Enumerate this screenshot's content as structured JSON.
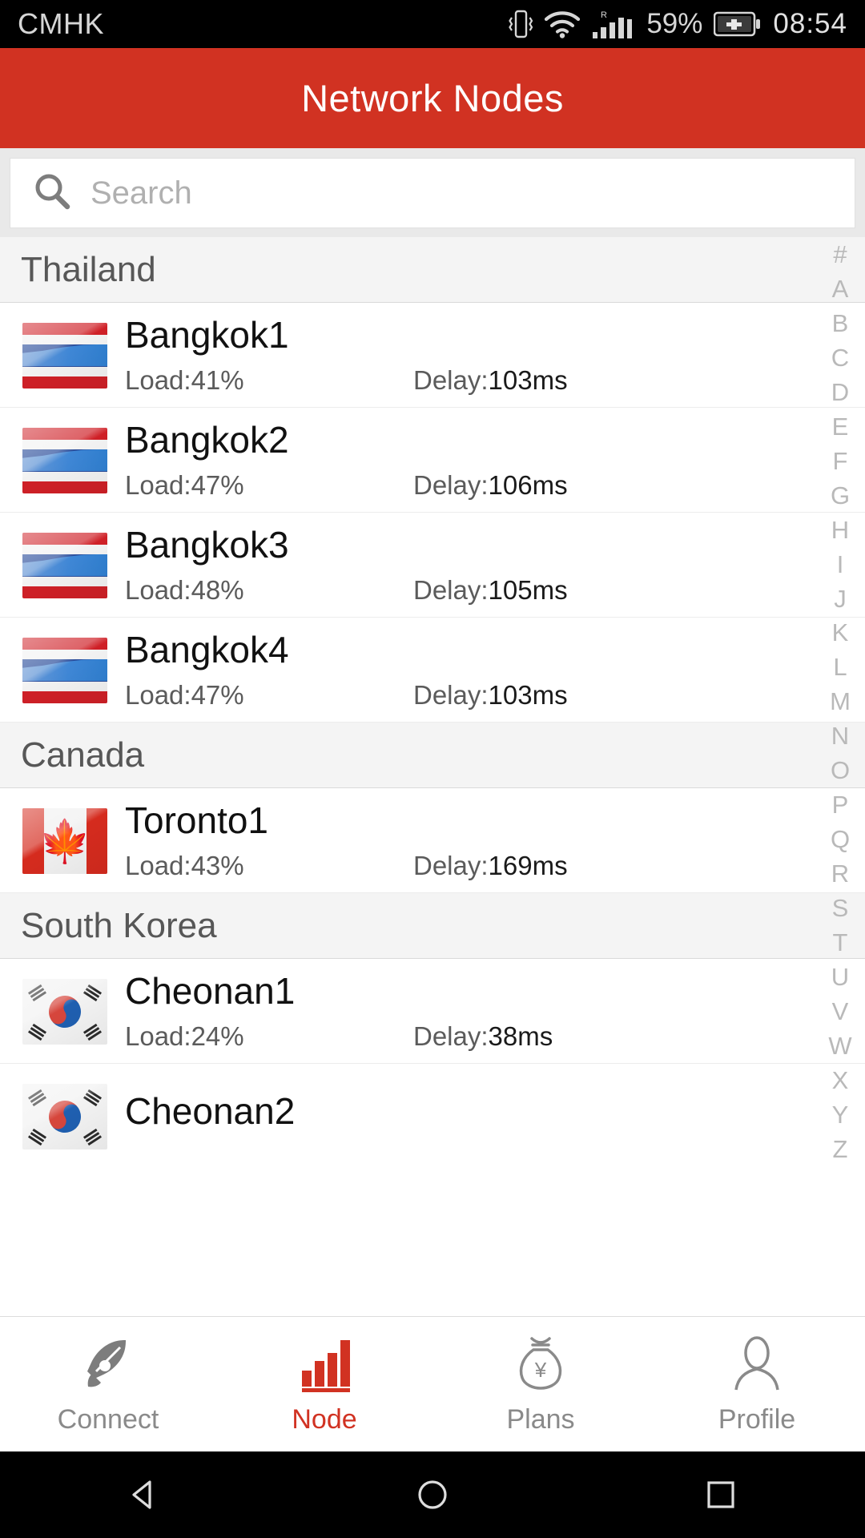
{
  "status_bar": {
    "carrier": "CMHK",
    "battery_percent": "59%",
    "clock": "08:54",
    "icons": [
      "vibrate-icon",
      "wifi-icon",
      "signal-icon",
      "battery-charging-icon"
    ]
  },
  "header": {
    "title": "Network Nodes"
  },
  "search": {
    "placeholder": "Search",
    "value": "",
    "icon": "search-icon"
  },
  "alpha_index": [
    "#",
    "A",
    "B",
    "C",
    "D",
    "E",
    "F",
    "G",
    "H",
    "I",
    "J",
    "K",
    "L",
    "M",
    "N",
    "O",
    "P",
    "Q",
    "R",
    "S",
    "T",
    "U",
    "V",
    "W",
    "X",
    "Y",
    "Z"
  ],
  "sections": [
    {
      "country": "Thailand",
      "flag": "thailand-flag",
      "nodes": [
        {
          "name": "Bangkok1",
          "load": "Load:41%",
          "delay_label": "Delay:",
          "delay": "103ms"
        },
        {
          "name": "Bangkok2",
          "load": "Load:47%",
          "delay_label": "Delay:",
          "delay": "106ms"
        },
        {
          "name": "Bangkok3",
          "load": "Load:48%",
          "delay_label": "Delay:",
          "delay": "105ms"
        },
        {
          "name": "Bangkok4",
          "load": "Load:47%",
          "delay_label": "Delay:",
          "delay": "103ms"
        }
      ]
    },
    {
      "country": "Canada",
      "flag": "canada-flag",
      "nodes": [
        {
          "name": "Toronto1",
          "load": "Load:43%",
          "delay_label": "Delay:",
          "delay": "169ms"
        }
      ]
    },
    {
      "country": "South Korea",
      "flag": "south-korea-flag",
      "nodes": [
        {
          "name": "Cheonan1",
          "load": "Load:24%",
          "delay_label": "Delay:",
          "delay": "38ms"
        },
        {
          "name": "Cheonan2",
          "load": "",
          "delay_label": "",
          "delay": ""
        }
      ]
    }
  ],
  "tabbar": {
    "active": "Node",
    "items": [
      {
        "label": "Connect",
        "icon": "rocket-icon"
      },
      {
        "label": "Node",
        "icon": "bar-chart-icon"
      },
      {
        "label": "Plans",
        "icon": "money-bag-icon"
      },
      {
        "label": "Profile",
        "icon": "person-icon"
      }
    ]
  },
  "android_nav": {
    "back": "back-triangle-icon",
    "home": "home-circle-icon",
    "recents": "recents-square-icon"
  },
  "colors": {
    "accent": "#d13222",
    "header_bg": "#d13222",
    "section_bg": "#f4f4f4"
  }
}
